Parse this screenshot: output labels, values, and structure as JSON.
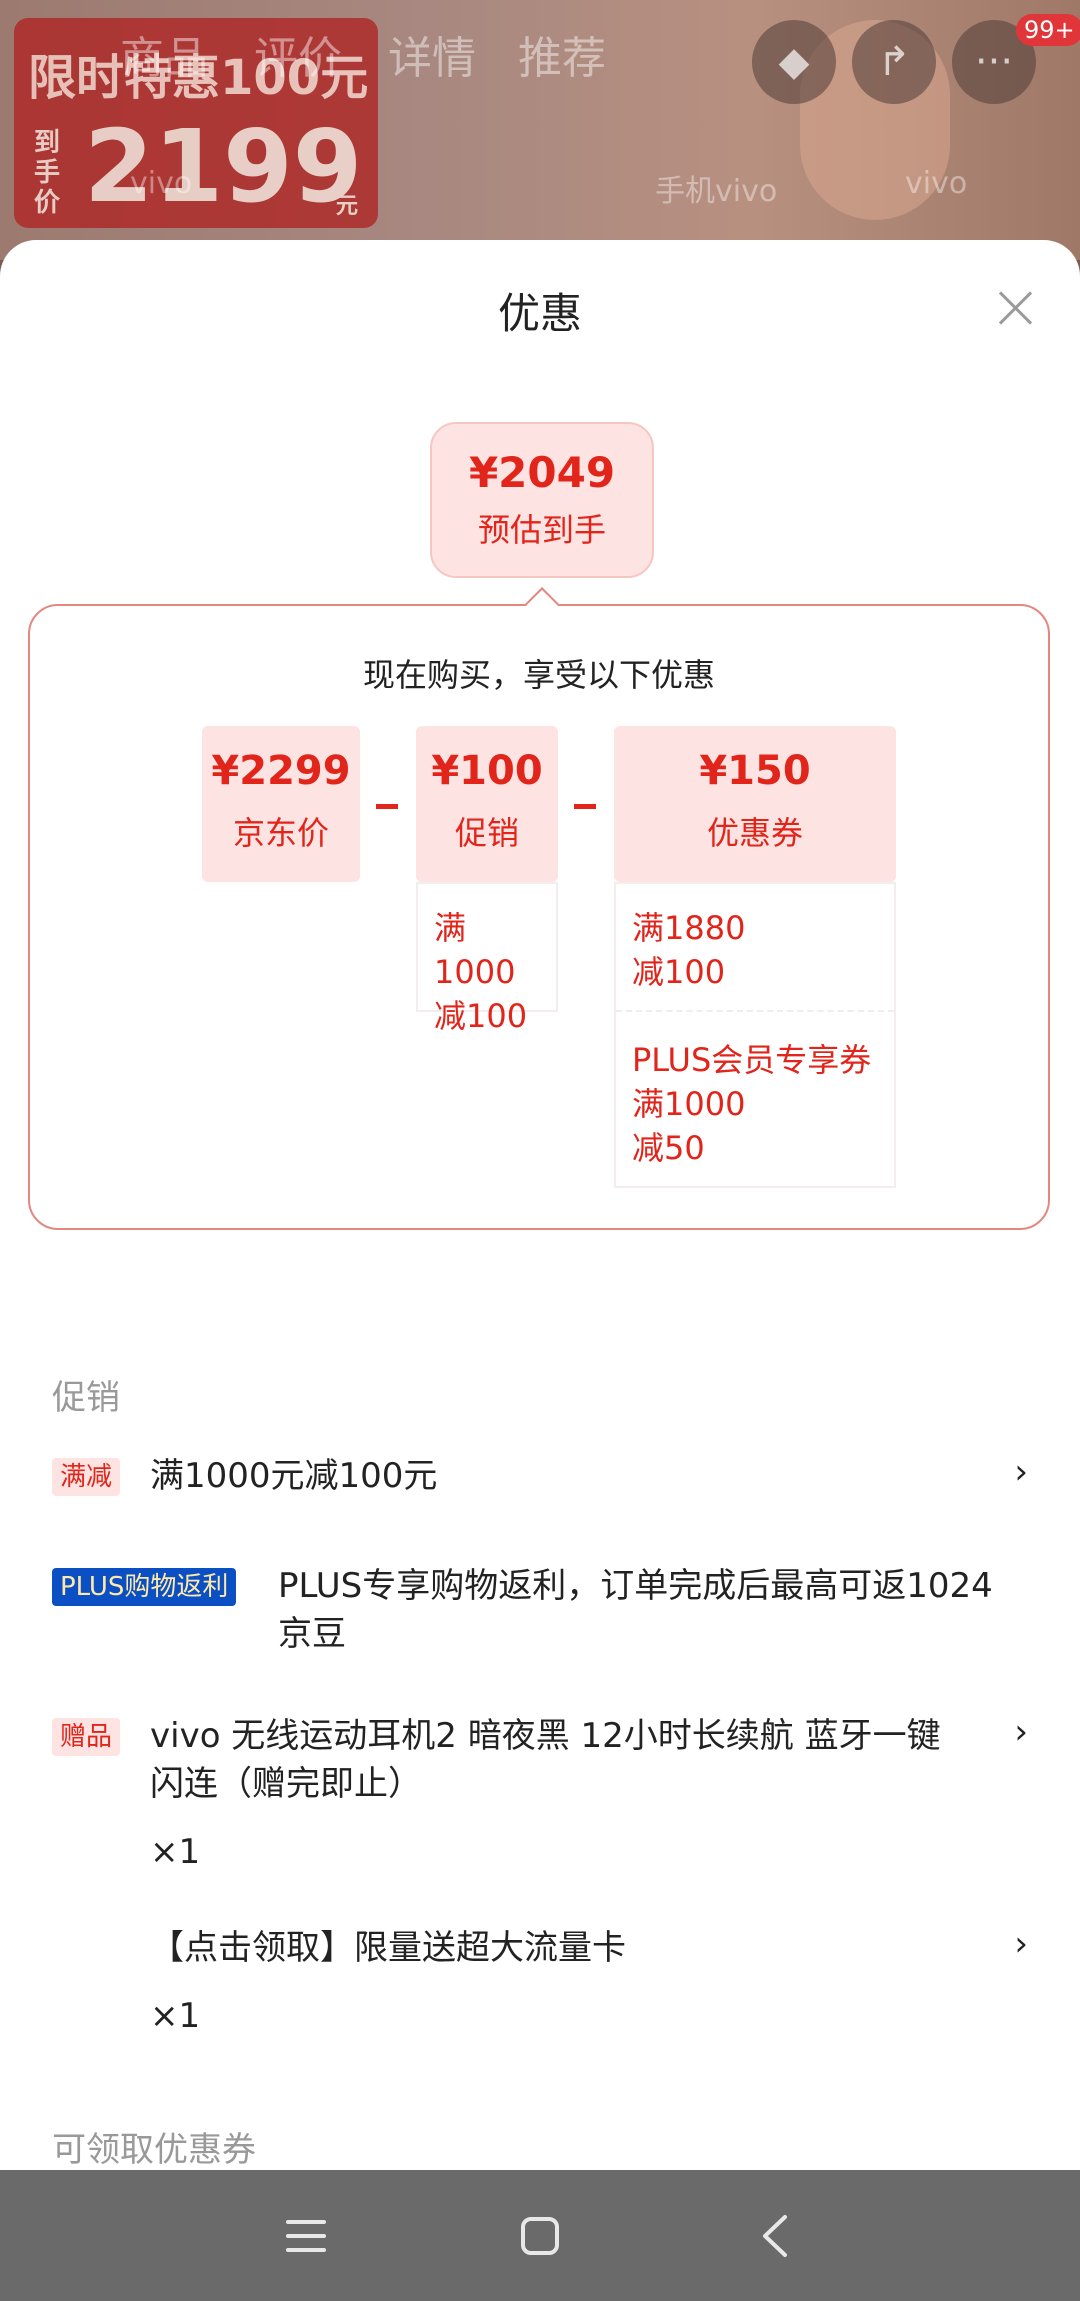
{
  "background": {
    "tabs": [
      "商品",
      "评价",
      "详情",
      "推荐"
    ],
    "promo_title": "限时特惠100元",
    "promo_side": "到手价",
    "promo_price": "2199",
    "promo_unit": "元",
    "brand_texts": [
      "vivo",
      "手机vivo",
      "vivo"
    ],
    "cart_badge": "99+"
  },
  "sheet": {
    "title": "优惠",
    "estimate": {
      "price": "¥2049",
      "label": "预估到手"
    },
    "calc_subtitle": "现在购买，享受以下优惠",
    "jd_price": {
      "value": "¥2299",
      "label": "京东价"
    },
    "promotion": {
      "value": "¥100",
      "label": "促销",
      "details": [
        "满1000",
        "减100"
      ]
    },
    "coupon": {
      "value": "¥150",
      "label": "优惠券",
      "details_a": [
        "满1880",
        "减100"
      ],
      "details_b": [
        "PLUS会员专享券",
        "满1000",
        "减50"
      ]
    }
  },
  "promo_section": {
    "label": "促销",
    "items": [
      {
        "tag": "满减",
        "text": "满1000元减100元"
      },
      {
        "tag": "PLUS购物返利",
        "text_line1": "PLUS专享购物返利，订单完成后最高可返1024",
        "text_line2": "京豆"
      },
      {
        "tag": "赠品",
        "text_line1": "vivo 无线运动耳机2 暗夜黑 12小时长续航 蓝牙一键",
        "text_line2": "闪连（赠完即止）",
        "qty": "×1"
      },
      {
        "text": "【点击领取】限量送超大流量卡",
        "qty": "×1"
      }
    ]
  },
  "coupon_section": {
    "label": "可领取优惠券"
  },
  "chevron": "›",
  "colors": {
    "accent": "#e1251b",
    "tag_bg": "#fde4e2",
    "plus_blue": "#0a4fc4",
    "nav_bar": "#6a6a6a"
  }
}
